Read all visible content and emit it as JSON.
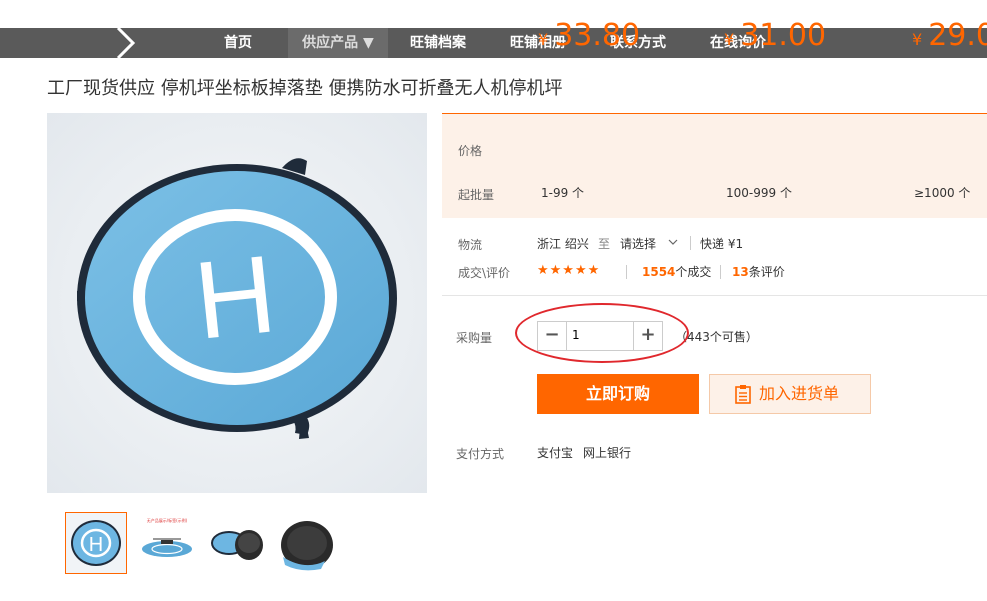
{
  "nav": {
    "items": [
      {
        "label": "首页",
        "active": false
      },
      {
        "label": "供应产品 ▼",
        "active": true
      },
      {
        "label": "旺铺档案",
        "active": false
      },
      {
        "label": "旺铺相册",
        "active": false
      },
      {
        "label": "联系方式",
        "active": false
      },
      {
        "label": "在线询价",
        "active": false
      }
    ],
    "background": "#5a5a5a"
  },
  "product": {
    "title": "工厂现货供应 停机坪坐标板掉落垫 便携防水可折叠无人机停机坪",
    "image_letter": "H",
    "thumb_caption": "无产品展示/标签(示例)"
  },
  "pricing": {
    "price_label": "价格",
    "moq_label": "起批量",
    "tiers": [
      {
        "currency": "¥",
        "price": "33.80",
        "range": "1-99 个"
      },
      {
        "currency": "¥",
        "price": "31.00",
        "range": "100-999 个"
      },
      {
        "currency": "¥",
        "price": "29.0",
        "range": "≥1000 个"
      }
    ],
    "accent": "#ff6600"
  },
  "logistics": {
    "label": "物流",
    "from": "浙江 绍兴",
    "to_word": "至",
    "dest": "请选择",
    "shipping": "快递 ¥1"
  },
  "deal": {
    "label": "成交\\评价",
    "stars": "★★★★★",
    "deals_count": "1554",
    "deals_suffix": "个成交",
    "reviews_count": "13",
    "reviews_suffix": "条评价"
  },
  "purchase": {
    "label": "采购量",
    "quantity": "1",
    "available": "（443个可售）"
  },
  "actions": {
    "buy": "立即订购",
    "cart": "加入进货单"
  },
  "payment": {
    "label": "支付方式",
    "methods": [
      "支付宝",
      "网上银行"
    ]
  }
}
